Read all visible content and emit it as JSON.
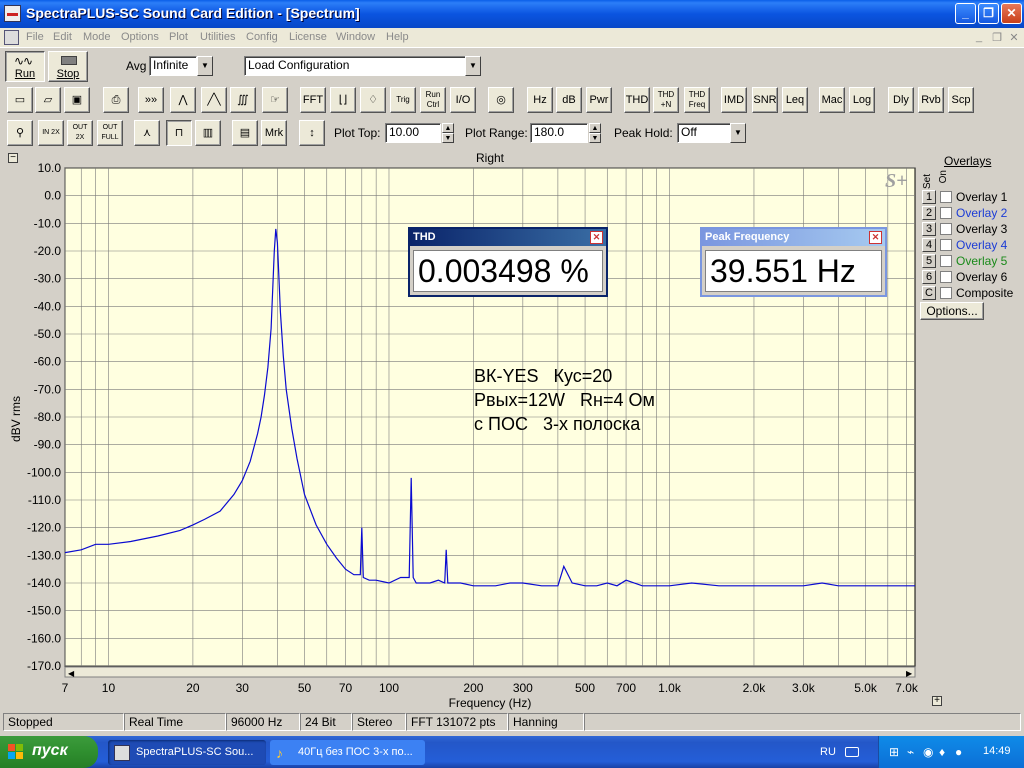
{
  "window": {
    "title": "SpectraPLUS-SC Sound Card Edition - [Spectrum]",
    "min": "_",
    "max": "❐",
    "close": "✕"
  },
  "menu": [
    "File",
    "Edit",
    "Mode",
    "Options",
    "Plot",
    "Utilities",
    "Config",
    "License",
    "Window",
    "Help"
  ],
  "mdi_controls": [
    "_",
    "❐",
    "✕"
  ],
  "toolbar1": {
    "run": "Run",
    "stop": "Stop",
    "avg_label": "Avg",
    "avg_value": "Infinite",
    "config_value": "Load Configuration"
  },
  "toolbar2": [
    {
      "name": "new-icon",
      "g": "▭"
    },
    {
      "name": "open-icon",
      "g": "▱"
    },
    {
      "name": "save-icon",
      "g": "▣"
    },
    {
      "name": "print-icon",
      "g": "⎙"
    },
    {
      "name": "fast-forward-icon",
      "g": "»»"
    },
    {
      "name": "scope-icon",
      "g": "⋀"
    },
    {
      "name": "waveform-icon",
      "g": "╱╲"
    },
    {
      "name": "coil-icon",
      "g": "∭"
    },
    {
      "name": "hand-icon",
      "g": "☞"
    },
    {
      "name": "fft-button",
      "g": "FFT"
    },
    {
      "name": "window-icon",
      "g": "⌊⌋"
    },
    {
      "name": "bell-icon",
      "g": "♢"
    },
    {
      "name": "trig-button",
      "g": "Trig"
    },
    {
      "name": "run-ctrl-button",
      "g": "Run Ctrl"
    },
    {
      "name": "io-button",
      "g": "I/O"
    },
    {
      "name": "signal-gen-icon",
      "g": "◎"
    },
    {
      "name": "hz-button",
      "g": "Hz"
    },
    {
      "name": "db-button",
      "g": "dB"
    },
    {
      "name": "pwr-button",
      "g": "Pwr"
    },
    {
      "name": "thd-button",
      "g": "THD"
    },
    {
      "name": "thd-n-button",
      "g": "THD +N"
    },
    {
      "name": "thd-freq-button",
      "g": "THD Freq"
    },
    {
      "name": "imd-button",
      "g": "IMD"
    },
    {
      "name": "snr-button",
      "g": "SNR"
    },
    {
      "name": "leq-button",
      "g": "Leq"
    },
    {
      "name": "mac-button",
      "g": "Mac"
    },
    {
      "name": "log-button",
      "g": "Log"
    },
    {
      "name": "dly-button",
      "g": "Dly"
    },
    {
      "name": "rvb-button",
      "g": "Rvb"
    },
    {
      "name": "scp-button",
      "g": "Scp"
    }
  ],
  "toolbar3": {
    "buttons": [
      {
        "name": "zoom-icon",
        "g": "⚲"
      },
      {
        "name": "zoom-in-2x-button",
        "g": "IN 2X"
      },
      {
        "name": "zoom-out-2x-button",
        "g": "OUT 2X"
      },
      {
        "name": "zoom-out-full-button",
        "g": "OUT FULL"
      },
      {
        "name": "line-plot-icon",
        "g": "⋏"
      },
      {
        "name": "step-plot-icon",
        "g": "⊓"
      },
      {
        "name": "bar-plot-icon",
        "g": "▥"
      },
      {
        "name": "grid-icon",
        "g": "▤"
      },
      {
        "name": "mrk-button",
        "g": "Mrk"
      },
      {
        "name": "range-icon",
        "g": "↕"
      }
    ],
    "plot_top_label": "Plot Top:",
    "plot_top_value": "10.00",
    "plot_range_label": "Plot Range:",
    "plot_range_value": "180.0",
    "peak_hold_label": "Peak Hold:",
    "peak_hold_value": "Off"
  },
  "plot": {
    "channel_label": "Right",
    "collapse": "−",
    "expand": "+",
    "watermark": "S+",
    "annotations": [
      "ВК-YES   Кус=20",
      "Рвых=12W   Rн=4 Ом",
      "с ПОС   3-х полоска"
    ]
  },
  "thd_panel": {
    "title": "THD",
    "value": "0.003498 %",
    "close": "✕"
  },
  "peak_panel": {
    "title": "Peak Frequency",
    "value": "39.551 Hz",
    "close": "✕"
  },
  "overlays": {
    "title": "Overlays",
    "header_set": "Set",
    "header_on": "On",
    "items": [
      {
        "num": "1",
        "name": "Overlay 1",
        "color": "#000000"
      },
      {
        "num": "2",
        "name": "Overlay 2",
        "color": "#1c3cd6"
      },
      {
        "num": "3",
        "name": "Overlay 3",
        "color": "#000000"
      },
      {
        "num": "4",
        "name": "Overlay 4",
        "color": "#1c3cd6"
      },
      {
        "num": "5",
        "name": "Overlay 5",
        "color": "#1a8a1a"
      },
      {
        "num": "6",
        "name": "Overlay 6",
        "color": "#000000"
      },
      {
        "num": "C",
        "name": "Composite",
        "color": "#000000"
      }
    ],
    "options_button": "Options..."
  },
  "status": [
    "Stopped",
    "Real Time",
    "96000 Hz",
    "24 Bit",
    "Stereo",
    "FFT 131072 pts",
    "Hanning"
  ],
  "taskbar": {
    "start": "пуск",
    "tasks": [
      "SpectraPLUS-SC Sou...",
      "40Гц без ПОС 3-х по..."
    ],
    "lang": "RU",
    "clock": "14:49"
  },
  "chart_data": {
    "type": "line",
    "ylabel": "dBV rms",
    "xlabel": "Frequency (Hz)",
    "xscale": "log",
    "xlim": [
      7,
      7500
    ],
    "ylim": [
      -170,
      10
    ],
    "yticks": [
      10,
      0,
      -10,
      -20,
      -30,
      -40,
      -50,
      -60,
      -70,
      -80,
      -90,
      -100,
      -110,
      -120,
      -130,
      -140,
      -150,
      -160,
      -170
    ],
    "ytick_labels": [
      "10.0",
      "0.0",
      "-10.0",
      "-20.0",
      "-30.0",
      "-40.0",
      "-50.0",
      "-60.0",
      "-70.0",
      "-80.0",
      "-90.0",
      "-100.0",
      "-110.0",
      "-120.0",
      "-130.0",
      "-140.0",
      "-150.0",
      "-160.0",
      "-170.0"
    ],
    "xticks": [
      7,
      10,
      20,
      30,
      50,
      70,
      100,
      200,
      300,
      500,
      700,
      1000,
      2000,
      3000,
      5000,
      7000
    ],
    "xtick_labels": [
      "7",
      "10",
      "20",
      "30",
      "50",
      "70",
      "100",
      "200",
      "300",
      "500",
      "700",
      "1.0k",
      "2.0k",
      "3.0k",
      "5.0k",
      "7.0k"
    ],
    "grid": true,
    "series": [
      {
        "color": "#0a0ad0",
        "x": [
          7,
          8,
          9,
          10,
          12,
          15,
          18,
          20,
          22,
          25,
          28,
          30,
          32,
          34,
          35,
          36,
          37,
          38,
          39,
          39.5,
          40,
          41,
          42,
          43,
          45,
          47,
          50,
          55,
          60,
          65,
          70,
          75,
          79,
          80,
          81,
          85,
          90,
          100,
          110,
          118,
          120,
          122,
          125,
          140,
          150,
          158,
          160,
          162,
          180,
          200,
          240,
          270,
          300,
          350,
          400,
          420,
          450,
          500,
          550,
          600,
          650,
          700,
          800,
          900,
          1000,
          1200,
          1500,
          2000,
          2500,
          3000,
          3500,
          4000,
          5000,
          6000,
          7500
        ],
        "y": [
          -129,
          -128,
          -126,
          -126,
          -125,
          -123,
          -121,
          -119,
          -117,
          -114,
          -108,
          -103,
          -96,
          -86,
          -80,
          -72,
          -62,
          -48,
          -20,
          -12,
          -17,
          -42,
          -58,
          -70,
          -84,
          -95,
          -108,
          -119,
          -126,
          -131,
          -135,
          -137,
          -137,
          -120,
          -138,
          -139,
          -139,
          -140,
          -138,
          -138,
          -102,
          -138,
          -140,
          -140,
          -139,
          -140,
          -128,
          -140,
          -140,
          -141,
          -141,
          -140,
          -140,
          -141,
          -141,
          -134,
          -140,
          -141,
          -141,
          -140,
          -141,
          -139,
          -141,
          -141,
          -141,
          -140,
          -141,
          -141,
          -141,
          -141,
          -140,
          -141,
          -141,
          -141,
          -141
        ]
      }
    ]
  }
}
